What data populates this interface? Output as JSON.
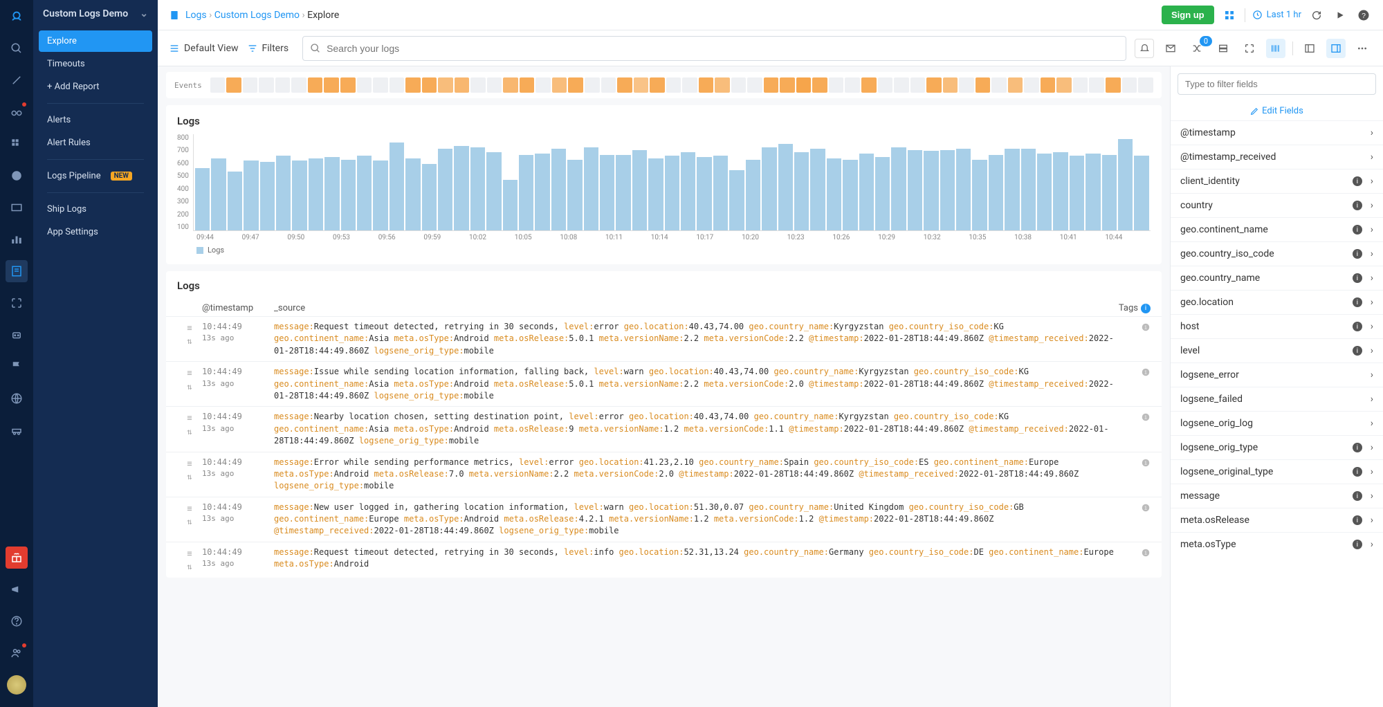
{
  "sidebar": {
    "title": "Custom Logs Demo",
    "items": [
      {
        "label": "Explore",
        "active": true
      },
      {
        "label": "Timeouts"
      },
      {
        "label": "+ Add Report",
        "add": true
      },
      {
        "sep": true
      },
      {
        "label": "Alerts"
      },
      {
        "label": "Alert Rules"
      },
      {
        "sep": true
      },
      {
        "label": "Logs Pipeline",
        "badge": "NEW"
      },
      {
        "sep": true
      },
      {
        "label": "Ship Logs"
      },
      {
        "label": "App Settings"
      }
    ]
  },
  "breadcrumb": {
    "icon": "document",
    "parts": [
      {
        "label": "Logs",
        "link": true
      },
      {
        "label": "Custom Logs Demo",
        "link": true
      },
      {
        "label": "Explore",
        "link": false
      }
    ]
  },
  "topbar": {
    "signup": "Sign up",
    "time_range": "Last 1 hr"
  },
  "toolbar": {
    "default_view": "Default View",
    "filters": "Filters",
    "search_placeholder": "Search your logs",
    "badge_count": "0"
  },
  "events_label": "Events",
  "events_cells": [
    0.0,
    0.9,
    0.0,
    0.0,
    0.0,
    0.0,
    0.9,
    0.9,
    0.9,
    0.0,
    0.0,
    0.0,
    0.9,
    0.9,
    0.6,
    0.7,
    0.0,
    0.0,
    0.7,
    0.9,
    0.0,
    0.6,
    0.9,
    0.0,
    0.0,
    0.9,
    0.5,
    0.9,
    0.0,
    0.0,
    0.9,
    0.6,
    0.0,
    0.0,
    0.9,
    0.9,
    1.0,
    0.9,
    0.0,
    0.0,
    0.9,
    0.0,
    0.0,
    0.0,
    0.9,
    0.6,
    0.0,
    0.9,
    0.0,
    0.6,
    0.0,
    0.9,
    0.6,
    0.0,
    0.0,
    0.9,
    0.0,
    0.0
  ],
  "chart_data": {
    "type": "bar",
    "title": "Logs",
    "ylabel": "",
    "xlabel": "",
    "ylim": [
      0,
      800
    ],
    "y_ticks": [
      "800",
      "700",
      "600",
      "500",
      "400",
      "300",
      "200",
      "100"
    ],
    "x_ticks": [
      "09:44",
      "09:47",
      "09:50",
      "09:53",
      "09:56",
      "09:59",
      "10:02",
      "10:05",
      "10:08",
      "10:11",
      "10:14",
      "10:17",
      "10:20",
      "10:23",
      "10:26",
      "10:29",
      "10:32",
      "10:35",
      "10:38",
      "10:41",
      "10:44"
    ],
    "legend": "Logs",
    "values": [
      520,
      600,
      490,
      580,
      570,
      620,
      580,
      600,
      610,
      590,
      620,
      580,
      730,
      600,
      550,
      680,
      700,
      690,
      650,
      420,
      630,
      640,
      680,
      590,
      690,
      630,
      630,
      670,
      600,
      620,
      650,
      610,
      620,
      500,
      590,
      690,
      720,
      650,
      680,
      600,
      590,
      640,
      610,
      690,
      670,
      660,
      670,
      680,
      590,
      630,
      680,
      680,
      640,
      650,
      620,
      640,
      630,
      760,
      620
    ]
  },
  "logs": {
    "title": "Logs",
    "columns": {
      "timestamp": "@timestamp",
      "source": "_source",
      "tags": "Tags"
    },
    "rows": [
      {
        "ts": "10:44:49",
        "rel": "13s ago",
        "kv": [
          [
            "message:",
            "Request timeout detected, retrying in 30 seconds, "
          ],
          [
            "level:",
            "error "
          ],
          [
            "geo.location:",
            "40.43,74.00 "
          ],
          [
            "geo.country_name:",
            "Kyrgyzstan "
          ],
          [
            "geo.country_iso_code:",
            "KG "
          ],
          [
            "geo.continent_name:",
            "Asia "
          ],
          [
            "meta.osType:",
            "Android "
          ],
          [
            "meta.osRelease:",
            "5.0.1 "
          ],
          [
            "meta.versionName:",
            "2.2 "
          ],
          [
            "meta.versionCode:",
            "2.2 "
          ],
          [
            "@timestamp:",
            "2022-01-28T18:44:49.860Z "
          ],
          [
            "@timestamp_received:",
            "2022-01-28T18:44:49.860Z "
          ],
          [
            "logsene_orig_type:",
            "mobile"
          ]
        ]
      },
      {
        "ts": "10:44:49",
        "rel": "13s ago",
        "kv": [
          [
            "message:",
            "Issue while sending location information, falling back, "
          ],
          [
            "level:",
            "warn "
          ],
          [
            "geo.location:",
            "40.43,74.00 "
          ],
          [
            "geo.country_name:",
            "Kyrgyzstan "
          ],
          [
            "geo.country_iso_code:",
            "KG "
          ],
          [
            "geo.continent_name:",
            "Asia "
          ],
          [
            "meta.osType:",
            "Android "
          ],
          [
            "meta.osRelease:",
            "5.0.1 "
          ],
          [
            "meta.versionName:",
            "2.2 "
          ],
          [
            "meta.versionCode:",
            "2.0 "
          ],
          [
            "@timestamp:",
            "2022-01-28T18:44:49.860Z "
          ],
          [
            "@timestamp_received:",
            "2022-01-28T18:44:49.860Z "
          ],
          [
            "logsene_orig_type:",
            "mobile"
          ]
        ]
      },
      {
        "ts": "10:44:49",
        "rel": "13s ago",
        "kv": [
          [
            "message:",
            "Nearby location chosen, setting destination point, "
          ],
          [
            "level:",
            "error "
          ],
          [
            "geo.location:",
            "40.43,74.00 "
          ],
          [
            "geo.country_name:",
            "Kyrgyzstan "
          ],
          [
            "geo.country_iso_code:",
            "KG "
          ],
          [
            "geo.continent_name:",
            "Asia "
          ],
          [
            "meta.osType:",
            "Android "
          ],
          [
            "meta.osRelease:",
            "9 "
          ],
          [
            "meta.versionName:",
            "1.2 "
          ],
          [
            "meta.versionCode:",
            "1.1 "
          ],
          [
            "@timestamp:",
            "2022-01-28T18:44:49.860Z "
          ],
          [
            "@timestamp_received:",
            "2022-01-28T18:44:49.860Z "
          ],
          [
            "logsene_orig_type:",
            "mobile"
          ]
        ]
      },
      {
        "ts": "10:44:49",
        "rel": "13s ago",
        "kv": [
          [
            "message:",
            "Error while sending performance metrics, "
          ],
          [
            "level:",
            "error "
          ],
          [
            "geo.location:",
            "41.23,2.10 "
          ],
          [
            "geo.country_name:",
            "Spain "
          ],
          [
            "geo.country_iso_code:",
            "ES "
          ],
          [
            "geo.continent_name:",
            "Europe "
          ],
          [
            "meta.osType:",
            "Android "
          ],
          [
            "meta.osRelease:",
            "7.0 "
          ],
          [
            "meta.versionName:",
            "2.2 "
          ],
          [
            "meta.versionCode:",
            "2.0 "
          ],
          [
            "@timestamp:",
            "2022-01-28T18:44:49.860Z "
          ],
          [
            "@timestamp_received:",
            "2022-01-28T18:44:49.860Z "
          ],
          [
            "logsene_orig_type:",
            "mobile"
          ]
        ]
      },
      {
        "ts": "10:44:49",
        "rel": "13s ago",
        "kv": [
          [
            "message:",
            "New user logged in, gathering location information, "
          ],
          [
            "level:",
            "warn "
          ],
          [
            "geo.location:",
            "51.30,0.07 "
          ],
          [
            "geo.country_name:",
            "United Kingdom "
          ],
          [
            "geo.country_iso_code:",
            "GB "
          ],
          [
            "geo.continent_name:",
            "Europe "
          ],
          [
            "meta.osType:",
            "Android "
          ],
          [
            "meta.osRelease:",
            "4.2.1 "
          ],
          [
            "meta.versionName:",
            "1.2 "
          ],
          [
            "meta.versionCode:",
            "1.2 "
          ],
          [
            "@timestamp:",
            "2022-01-28T18:44:49.860Z "
          ],
          [
            "@timestamp_received:",
            "2022-01-28T18:44:49.860Z "
          ],
          [
            "logsene_orig_type:",
            "mobile"
          ]
        ]
      },
      {
        "ts": "10:44:49",
        "rel": "13s ago",
        "kv": [
          [
            "message:",
            "Request timeout detected, retrying in 30 seconds, "
          ],
          [
            "level:",
            "info "
          ],
          [
            "geo.location:",
            "52.31,13.24 "
          ],
          [
            "geo.country_name:",
            "Germany "
          ],
          [
            "geo.country_iso_code:",
            "DE "
          ],
          [
            "geo.continent_name:",
            "Europe "
          ],
          [
            "meta.osType:",
            "Android"
          ]
        ]
      }
    ]
  },
  "fields": {
    "filter_placeholder": "Type to filter fields",
    "edit_label": "Edit Fields",
    "items": [
      {
        "name": "@timestamp",
        "info": false
      },
      {
        "name": "@timestamp_received",
        "info": false
      },
      {
        "name": "client_identity",
        "info": true
      },
      {
        "name": "country",
        "info": true
      },
      {
        "name": "geo.continent_name",
        "info": true
      },
      {
        "name": "geo.country_iso_code",
        "info": true
      },
      {
        "name": "geo.country_name",
        "info": true
      },
      {
        "name": "geo.location",
        "info": true
      },
      {
        "name": "host",
        "info": true
      },
      {
        "name": "level",
        "info": true
      },
      {
        "name": "logsene_error",
        "info": false
      },
      {
        "name": "logsene_failed",
        "info": false
      },
      {
        "name": "logsene_orig_log",
        "info": false
      },
      {
        "name": "logsene_orig_type",
        "info": true
      },
      {
        "name": "logsene_original_type",
        "info": true
      },
      {
        "name": "message",
        "info": true
      },
      {
        "name": "meta.osRelease",
        "info": true
      },
      {
        "name": "meta.osType",
        "info": true
      }
    ]
  }
}
